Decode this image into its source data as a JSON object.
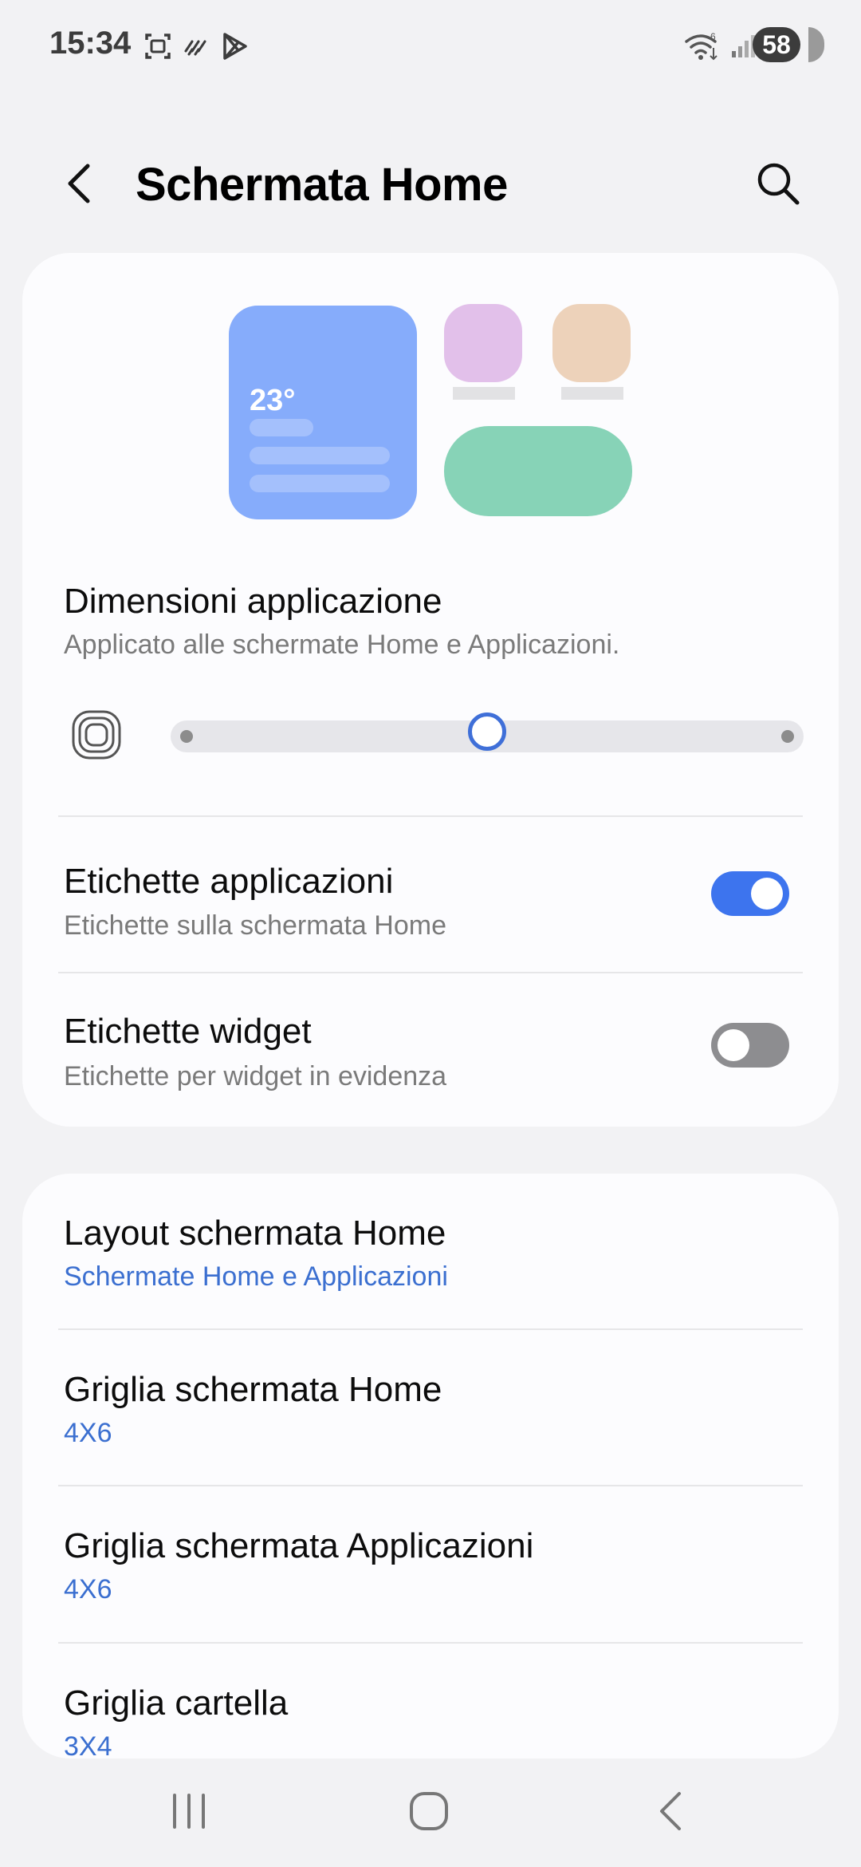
{
  "status": {
    "time": "15:34",
    "battery": "58",
    "icons": [
      "screenshot-icon",
      "rain-icon",
      "play-store-icon",
      "wifi-icon",
      "signal-icon"
    ]
  },
  "header": {
    "title": "Schermata Home",
    "back_icon": "back-arrow-icon",
    "search_icon": "search-icon"
  },
  "preview": {
    "temperature": "23°",
    "colors": {
      "widget_blue": "#86acfb",
      "app_pink": "#e2c0ea",
      "app_peach": "#edd2ba",
      "widget_green": "#87d3b7"
    }
  },
  "app_size": {
    "title": "Dimensioni applicazione",
    "subtitle": "Applicato alle schermate Home e Applicazioni.",
    "slider_level": 0.5,
    "icon": "app-size-icon"
  },
  "app_labels": {
    "title": "Etichette applicazioni",
    "subtitle": "Etichette sulla schermata Home",
    "enabled": true
  },
  "widget_labels": {
    "title": "Etichette widget",
    "subtitle": "Etichette per widget in evidenza",
    "enabled": false
  },
  "settings": [
    {
      "title": "Layout schermata Home",
      "value": "Schermate Home e Applicazioni"
    },
    {
      "title": "Griglia schermata Home",
      "value": "4X6"
    },
    {
      "title": "Griglia schermata Applicazioni",
      "value": "4X6"
    },
    {
      "title": "Griglia cartella",
      "value": "3X4"
    }
  ],
  "accent_color": "#3d74ee",
  "nav": {
    "icons": [
      "recent-apps-icon",
      "home-icon",
      "back-icon"
    ]
  }
}
